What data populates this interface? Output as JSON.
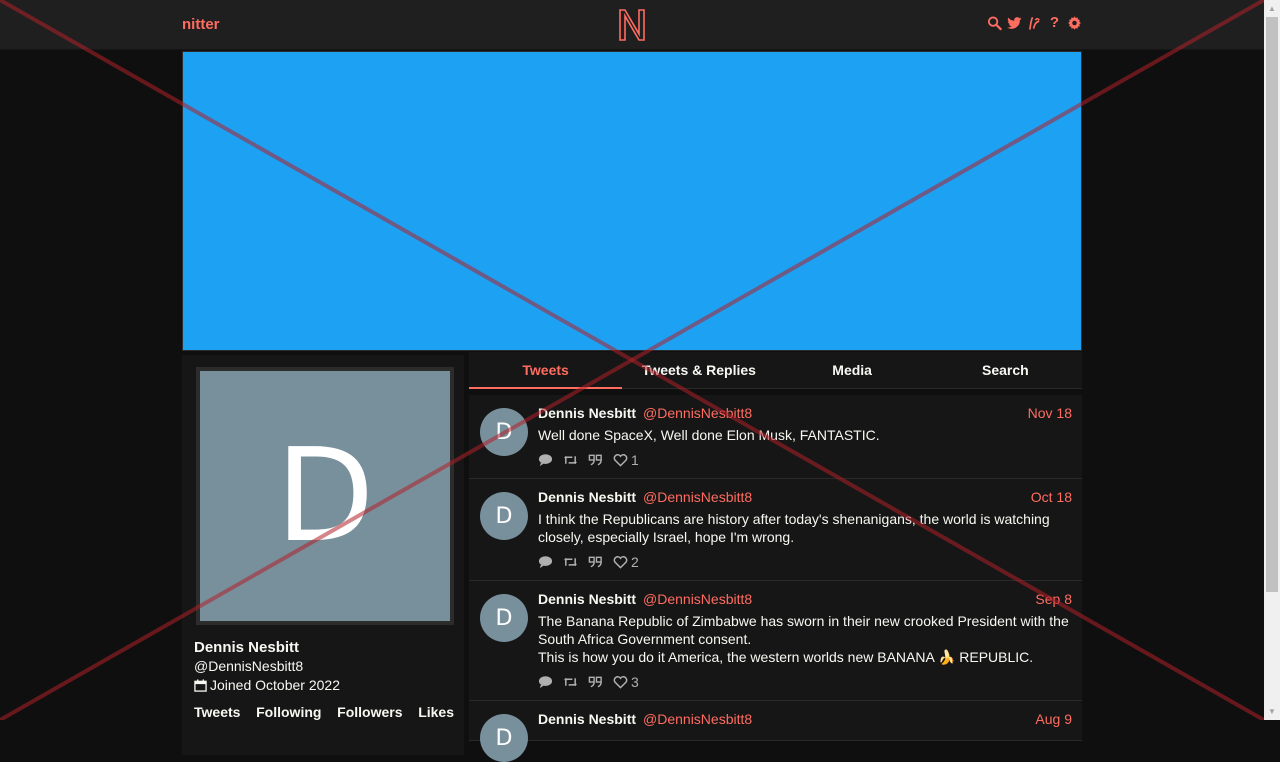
{
  "nav": {
    "brand": "nitter",
    "logo_letter": "N",
    "icons": [
      "search-icon",
      "twitter-bird-icon",
      "rss-icon",
      "help-icon",
      "gear-icon"
    ],
    "help_glyph": "?"
  },
  "colors": {
    "accent": "#ff6c60",
    "banner": "#1da1f2",
    "avatar_bg": "#78909c",
    "background": "#0f0f0f",
    "card": "#161616"
  },
  "profile": {
    "avatar_letter": "D",
    "name": "Dennis Nesbitt",
    "handle": "@DennisNesbitt8",
    "joined": "Joined October 2022",
    "stats": [
      "Tweets",
      "Following",
      "Followers",
      "Likes"
    ]
  },
  "tabs": [
    {
      "label": "Tweets",
      "active": true
    },
    {
      "label": "Tweets & Replies",
      "active": false
    },
    {
      "label": "Media",
      "active": false
    },
    {
      "label": "Search",
      "active": false
    }
  ],
  "tweets": [
    {
      "avatar_letter": "D",
      "name": "Dennis Nesbitt",
      "handle": "@DennisNesbitt8",
      "date": "Nov 18",
      "text": "Well done SpaceX, Well done Elon Musk, FANTASTIC.",
      "likes": "1"
    },
    {
      "avatar_letter": "D",
      "name": "Dennis Nesbitt",
      "handle": "@DennisNesbitt8",
      "date": "Oct 18",
      "text": "I think the Republicans are history after today's shenanigans, the world is watching closely, especially Israel, hope I'm wrong.",
      "likes": "2"
    },
    {
      "avatar_letter": "D",
      "name": "Dennis Nesbitt",
      "handle": "@DennisNesbitt8",
      "date": "Sep 8",
      "text": "The Banana Republic of Zimbabwe has sworn in their new crooked President with the South Africa Government consent.\nThis is how you do it America, the western worlds new BANANA 🍌 REPUBLIC.",
      "likes": "3"
    },
    {
      "avatar_letter": "D",
      "name": "Dennis Nesbitt",
      "handle": "@DennisNesbitt8",
      "date": "Aug 9",
      "text": "",
      "likes": ""
    }
  ]
}
